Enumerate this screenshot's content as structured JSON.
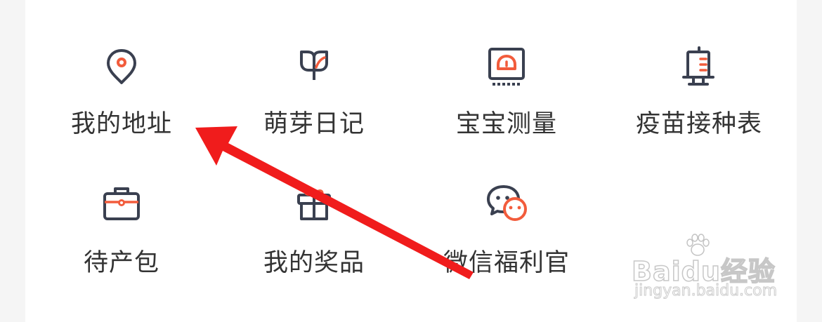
{
  "menu": {
    "items": [
      {
        "label": "我的地址",
        "icon": "location-pin-icon"
      },
      {
        "label": "萌芽日记",
        "icon": "sprout-diary-icon"
      },
      {
        "label": "宝宝测量",
        "icon": "baby-scale-icon"
      },
      {
        "label": "疫苗接种表",
        "icon": "vaccine-schedule-icon"
      },
      {
        "label": "待产包",
        "icon": "delivery-bag-icon"
      },
      {
        "label": "我的奖品",
        "icon": "gift-box-icon"
      },
      {
        "label": "微信福利官",
        "icon": "wechat-icon"
      }
    ]
  },
  "colors": {
    "icon_stroke": "#3a4050",
    "icon_accent": "#f25c3c",
    "label_text": "#333333",
    "annotation_arrow": "#f01c1c"
  },
  "watermark": {
    "brand": "Baidu经验",
    "url": "jingyan.baidu.com"
  }
}
